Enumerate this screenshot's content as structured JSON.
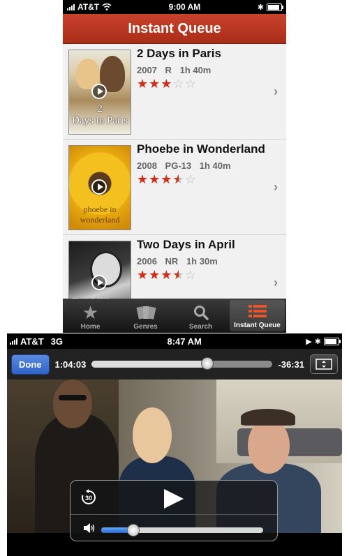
{
  "queue_screen": {
    "status": {
      "carrier": "AT&T",
      "time": "9:00 AM"
    },
    "title": "Instant Queue",
    "movies": [
      {
        "title": "2 Days in Paris",
        "year": "2007",
        "rating": "R",
        "runtime": "1h 40m",
        "stars": 3
      },
      {
        "title": "Phoebe in Wonderland",
        "year": "2008",
        "rating": "PG-13",
        "runtime": "1h 40m",
        "stars": 3.5
      },
      {
        "title": "Two Days in April",
        "year": "2006",
        "rating": "NR",
        "runtime": "1h 30m",
        "stars": 3.5
      }
    ],
    "tabs": [
      {
        "label": "Home",
        "icon": "star-icon"
      },
      {
        "label": "Genres",
        "icon": "genres-icon"
      },
      {
        "label": "Search",
        "icon": "search-icon"
      },
      {
        "label": "Instant Queue",
        "icon": "list-icon",
        "active": true
      }
    ]
  },
  "player_screen": {
    "status": {
      "carrier": "AT&T",
      "network": "3G",
      "time": "8:47 AM"
    },
    "done_label": "Done",
    "elapsed": "1:04:03",
    "remaining": "-36:31",
    "progress_fraction": 0.64,
    "volume_fraction": 0.2,
    "skip_seconds": "30"
  },
  "colors": {
    "accent_red": "#b9351e",
    "done_blue": "#2f63c6"
  }
}
